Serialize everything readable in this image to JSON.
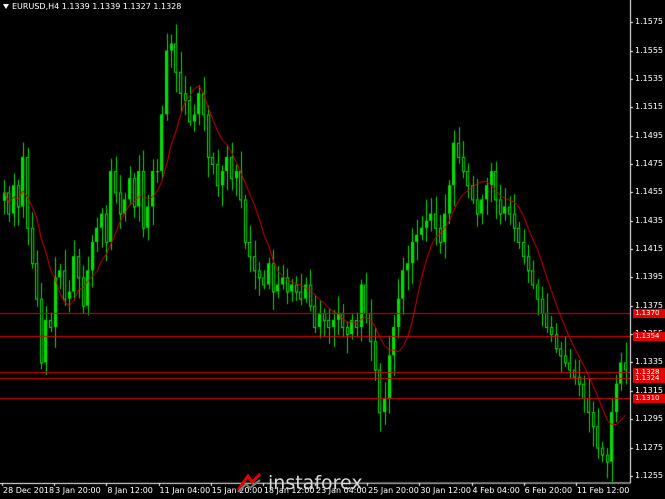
{
  "header": {
    "label": "EURUSD,H4  1.1339 1.1339 1.1327 1.1328"
  },
  "chart_data": {
    "type": "candlestick",
    "symbol": "EURUSD",
    "timeframe": "H4",
    "ohlc_current": {
      "open": 1.1339,
      "high": 1.1339,
      "low": 1.1327,
      "close": 1.1328
    },
    "ylim": [
      1.125,
      1.1585
    ],
    "y_ticks": [
      "1.1575",
      "1.1555",
      "1.1535",
      "1.1515",
      "1.1495",
      "1.1475",
      "1.1455",
      "1.1435",
      "1.1415",
      "1.1395",
      "1.1375",
      "1.1355",
      "1.1335",
      "1.1315",
      "1.1295",
      "1.1275",
      "1.1255"
    ],
    "x_ticks": [
      "28 Dec 2018",
      "3 Jan 20:00",
      "8 Jan 12:00",
      "11 Jan 04:00",
      "15 Jan 20:00",
      "18 Jan 12:00",
      "23 Jan 04:00",
      "25 Jan 20:00",
      "30 Jan 12:00",
      "4 Feb 04:00",
      "6 Feb 20:00",
      "11 Feb 12:00"
    ],
    "horizontal_levels": [
      {
        "value": 1.137,
        "label": "1.1370",
        "color": "#e00000"
      },
      {
        "value": 1.1354,
        "label": "1.1354",
        "color": "#e00000"
      },
      {
        "value": 1.1328,
        "label": "1.1328",
        "color": "#e00000"
      },
      {
        "value": 1.1324,
        "label": "1.1324",
        "color": "#e00000"
      },
      {
        "value": 1.131,
        "label": "1.1310",
        "color": "#e00000"
      }
    ],
    "closes": [
      1.1455,
      1.144,
      1.146,
      1.1445,
      1.148,
      1.143,
      1.1405,
      1.138,
      1.1335,
      1.1365,
      1.136,
      1.1395,
      1.14,
      1.138,
      1.1385,
      1.141,
      1.1395,
      1.1375,
      1.14,
      1.142,
      1.143,
      1.144,
      1.142,
      1.147,
      1.1455,
      1.144,
      1.145,
      1.1465,
      1.1445,
      1.147,
      1.143,
      1.1445,
      1.147,
      1.147,
      1.151,
      1.1555,
      1.156,
      1.154,
      1.1525,
      1.152,
      1.1505,
      1.151,
      1.1525,
      1.151,
      1.148,
      1.1475,
      1.146,
      1.147,
      1.148,
      1.1465,
      1.147,
      1.145,
      1.142,
      1.141,
      1.14,
      1.1395,
      1.139,
      1.1405,
      1.1385,
      1.139,
      1.1395,
      1.1385,
      1.139,
      1.1385,
      1.138,
      1.139,
      1.1375,
      1.136,
      1.137,
      1.1365,
      1.136,
      1.1365,
      1.137,
      1.136,
      1.1355,
      1.1365,
      1.136,
      1.139,
      1.137,
      1.135,
      1.133,
      1.13,
      1.131,
      1.134,
      1.136,
      1.138,
      1.14,
      1.1405,
      1.142,
      1.1425,
      1.143,
      1.1435,
      1.144,
      1.143,
      1.142,
      1.144,
      1.146,
      1.149,
      1.148,
      1.147,
      1.146,
      1.145,
      1.144,
      1.145,
      1.146,
      1.147,
      1.145,
      1.144,
      1.1445,
      1.144,
      1.143,
      1.142,
      1.141,
      1.14,
      1.139,
      1.138,
      1.137,
      1.136,
      1.1355,
      1.1345,
      1.134,
      1.1335,
      1.133,
      1.1325,
      1.132,
      1.131,
      1.13,
      1.129,
      1.1275,
      1.127,
      1.1265,
      1.13,
      1.132,
      1.1335,
      1.133
    ],
    "sma_color": "#e00000",
    "bull_color": "#00e000",
    "grid": false,
    "background": "#000000"
  },
  "watermark": {
    "text": "instaforex"
  }
}
